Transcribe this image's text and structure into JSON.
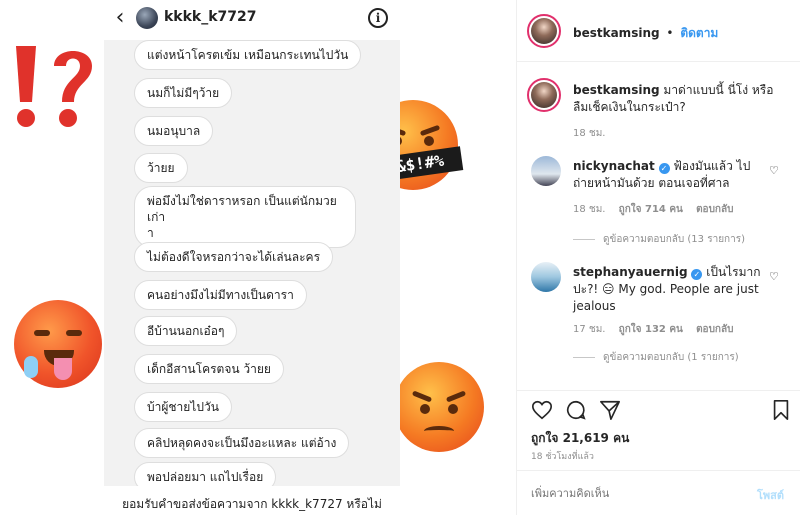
{
  "dm": {
    "username": "kkkk_k7727",
    "messages": [
      "แต่งหน้าโครตเข้ม เหมือนกระเทนไปวัน",
      "นมก็ไม่มีๆว้าย",
      "นมอนุบาล",
      "ว้ายย",
      "พ่อมึงไม่ใช่ดาราหรอก เป็นแต่นักมวยเก่า",
      "า",
      "ไม่ต้องดีใจหรอกว่าจะได้เล่นละคร",
      "คนอย่างมึงไม่มีทางเป็นดารา",
      "อีบ้านนอกเอ๋อๆ",
      "เด็กอีสานโครตจน ว้ายย",
      "บ้าผู้ชายไปวัน",
      "คลิปหลุดคงจะเป็นมึงอะแหละ แต่อ้าง",
      "พอปล่อยมา แถไปเรื่อย"
    ],
    "footer": "ยอมรับคำขอส่งข้อความจาก kkkk_k7727 หรือไม่",
    "grawlix": "&$!#%"
  },
  "post": {
    "username": "bestkamsing",
    "follow_sep": "•",
    "follow_label": "ติดตาม",
    "caption": "มาด่าแบบนี้ นี่โง่ หรือลืมเช็คเงินในกระเป๋า?",
    "caption_time": "18 ชม.",
    "comments": [
      {
        "username": "nickynachat",
        "text": "ฟ้องมันแล้ว ไปถ่ายหน้ามันด้วย ตอนเจอที่ศาล",
        "time": "18 ชม.",
        "likes": "ถูกใจ 714 คน",
        "reply": "ตอบกลับ",
        "view_replies": "ดูข้อความตอบกลับ (13 รายการ)"
      },
      {
        "username": "stephanyauernig",
        "text": "เป็นไรมากปะ?! 😑 My god. People are just jealous",
        "time": "17 ชม.",
        "likes": "ถูกใจ 132 คน",
        "reply": "ตอบกลับ",
        "view_replies": "ดูข้อความตอบกลับ (1 รายการ)"
      }
    ],
    "like_count": "ถูกใจ 21,619 คน",
    "post_time": "18 ชั่วโมงที่แล้ว",
    "comment_placeholder": "เพิ่มความคิดเห็น",
    "post_button": "โพสต์"
  },
  "colors": {
    "accent": "#3897f0",
    "story_ring": "#e1306c",
    "emoji_orange": "#f57a23",
    "interrobang_red": "#e0322b"
  }
}
